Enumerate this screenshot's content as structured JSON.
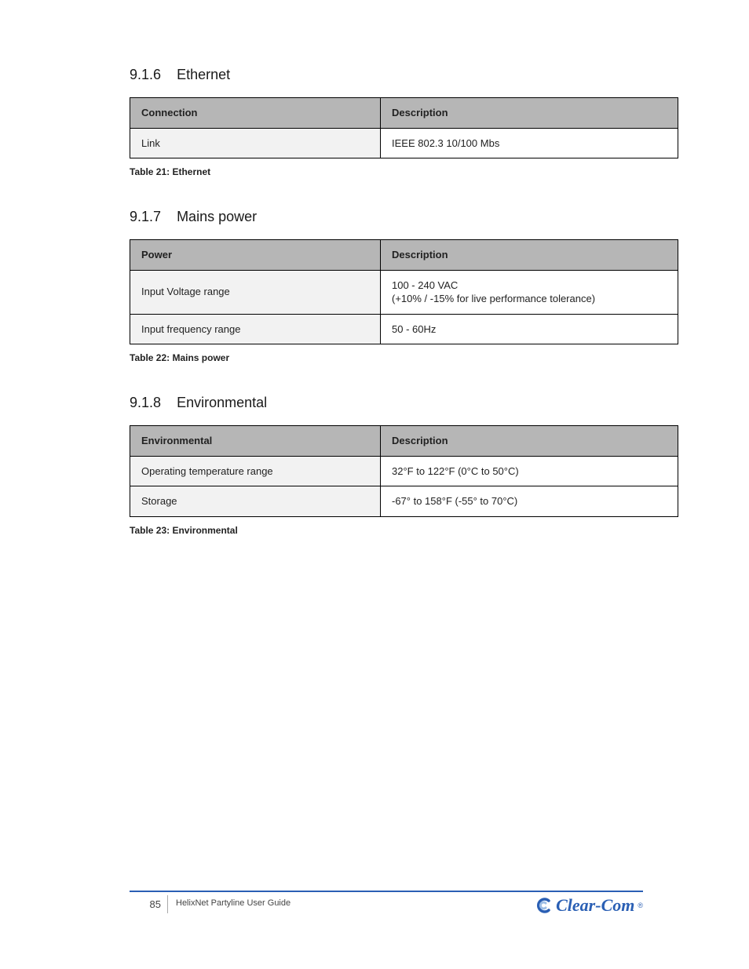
{
  "sections": [
    {
      "number": "9.1.6",
      "title": "Ethernet",
      "header_left": "Connection",
      "header_right": "Description",
      "rows": [
        {
          "label": "Link",
          "value": "IEEE 802.3 10/100 Mbs"
        }
      ],
      "caption": "Table 21: Ethernet"
    },
    {
      "number": "9.1.7",
      "title": "Mains power",
      "header_left": "Power",
      "header_right": "Description",
      "rows": [
        {
          "label": "Input Voltage range",
          "value": "100 - 240 VAC\n(+10% / -15% for live performance tolerance)"
        },
        {
          "label": "Input frequency range",
          "value": "50 - 60Hz"
        }
      ],
      "caption": "Table 22: Mains power"
    },
    {
      "number": "9.1.8",
      "title": "Environmental",
      "header_left": "Environmental",
      "header_right": "Description",
      "rows": [
        {
          "label": "Operating temperature range",
          "value": "32°F to 122°F (0°C to 50°C)"
        },
        {
          "label": "Storage",
          "value": "-67° to 158°F (-55° to 70°C)"
        }
      ],
      "caption": "Table 23: Environmental"
    }
  ],
  "footer": {
    "page_number": "85",
    "doc_title": "HelixNet Partyline User Guide",
    "brand": "Clear-Com"
  }
}
